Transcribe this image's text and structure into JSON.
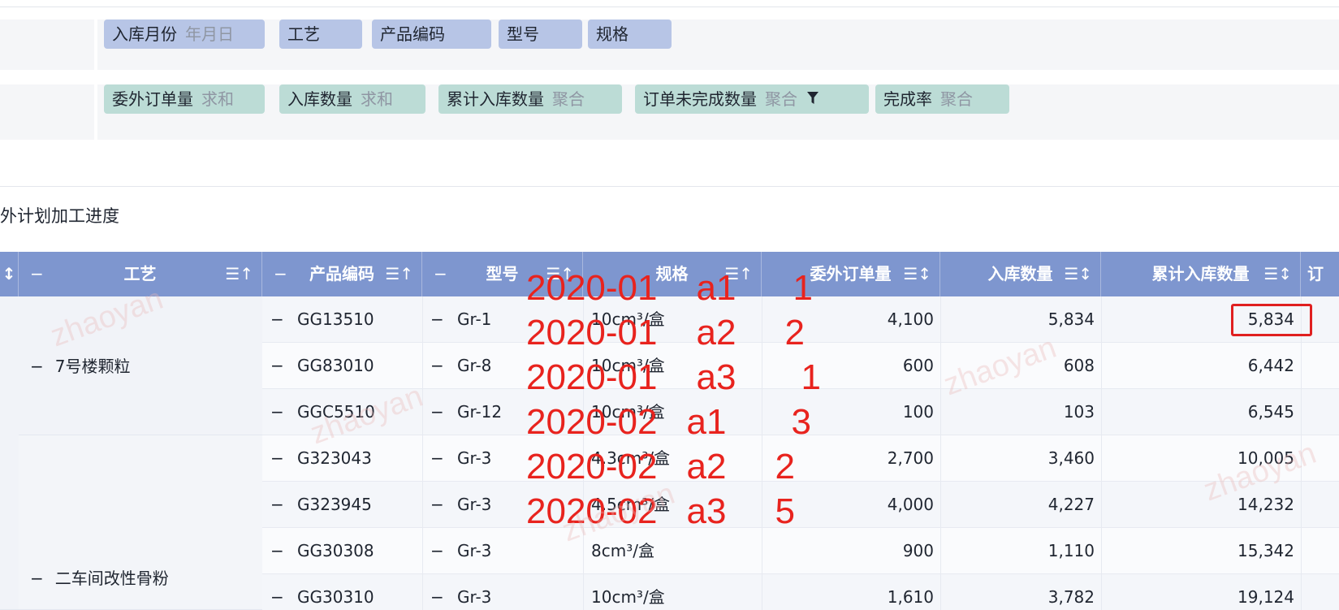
{
  "rows_dims": [
    {
      "label": "入库月份",
      "sub": "年月日"
    },
    {
      "label": "工艺",
      "sub": ""
    },
    {
      "label": "产品编码",
      "sub": ""
    },
    {
      "label": "型号",
      "sub": ""
    },
    {
      "label": "规格",
      "sub": ""
    }
  ],
  "measures": [
    {
      "label": "委外订单量",
      "sub": "求和"
    },
    {
      "label": "入库数量",
      "sub": "求和"
    },
    {
      "label": "累计入库数量",
      "sub": "聚合"
    },
    {
      "label": "订单未完成数量",
      "sub": "聚合"
    },
    {
      "label": "完成率",
      "sub": "聚合"
    }
  ],
  "title": "外计划加工进度",
  "headers": {
    "first": "↕",
    "craft": "工艺",
    "code": "产品编码",
    "model": "型号",
    "spec": "规格",
    "order": "委外订单量",
    "inbound": "入库数量",
    "cumulative": "累计入库数量",
    "last": "订"
  },
  "groups": [
    {
      "label": "7号楼颗粒"
    },
    {
      "label": "二车间改性骨粉"
    }
  ],
  "rows": [
    {
      "code": "GG13510",
      "model": "Gr-1",
      "spec": "10cm³/盒",
      "order": "4,100",
      "inbound": "5,834",
      "cumulative": "5,834"
    },
    {
      "code": "GG83010",
      "model": "Gr-8",
      "spec": "10cm³/盒",
      "order": "600",
      "inbound": "608",
      "cumulative": "6,442"
    },
    {
      "code": "GGC5510",
      "model": "Gr-12",
      "spec": "10cm³/盒",
      "order": "100",
      "inbound": "103",
      "cumulative": "6,545"
    },
    {
      "code": "G323043",
      "model": "Gr-3",
      "spec": "4.3cm³/盒",
      "order": "2,700",
      "inbound": "3,460",
      "cumulative": "10,005"
    },
    {
      "code": "G323945",
      "model": "Gr-3",
      "spec": "4.5cm³/盒",
      "order": "4,000",
      "inbound": "4,227",
      "cumulative": "14,232"
    },
    {
      "code": "GG30308",
      "model": "Gr-3",
      "spec": "8cm³/盒",
      "order": "900",
      "inbound": "1,110",
      "cumulative": "15,342"
    },
    {
      "code": "GG30310",
      "model": "Gr-3",
      "spec": "10cm³/盒",
      "order": "1,610",
      "inbound": "3,782",
      "cumulative": "19,124"
    }
  ],
  "annotations": [
    {
      "date": "2020-01",
      "key": "a1",
      "n": "1"
    },
    {
      "date": "2020-01",
      "key": "a2",
      "n": "2"
    },
    {
      "date": "2020-01",
      "key": "a3",
      "n": "1"
    },
    {
      "date": "2020-02",
      "key": "a1",
      "n": "3"
    },
    {
      "date": "2020-02",
      "key": "a2",
      "n": "2"
    },
    {
      "date": "2020-02",
      "key": "a3",
      "n": "5"
    }
  ],
  "watermark": "zhaoyan",
  "icons": {
    "minus": "minus-icon",
    "sort": "sort-icon",
    "filter": "filter-icon"
  }
}
